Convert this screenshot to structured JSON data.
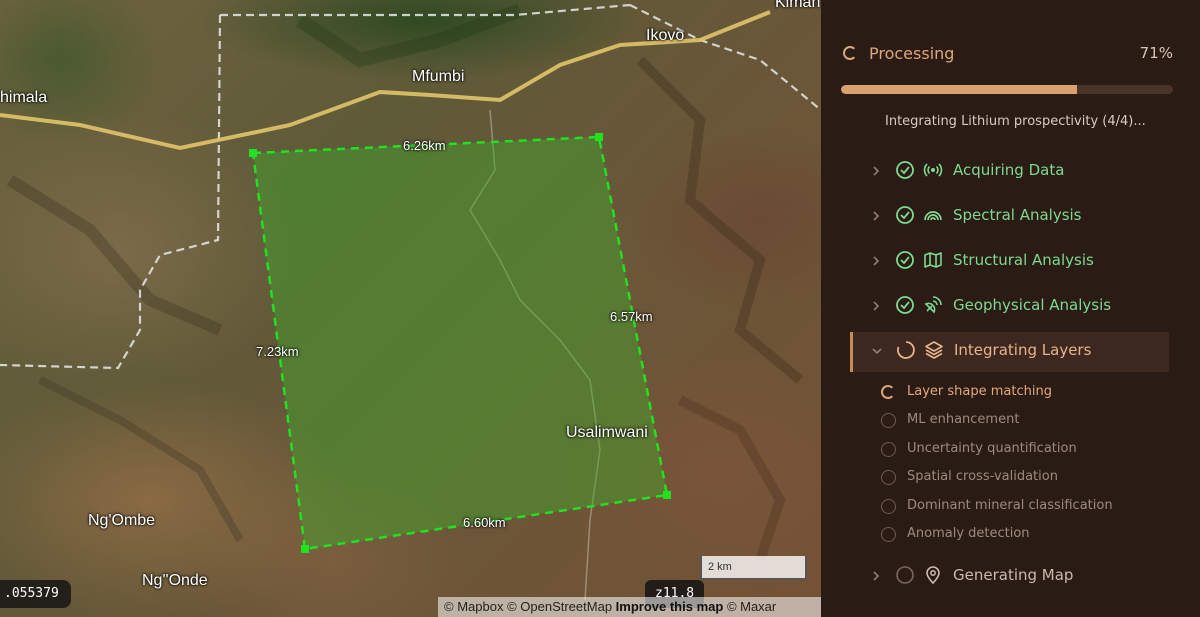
{
  "map": {
    "places": {
      "kimana": "Kiman",
      "ikovo": "Ikovo",
      "mfumbi": "Mfumbi",
      "chimala": "himala",
      "usalimwani": "Usalimwani",
      "ngombe": "Ng'Ombe",
      "ngonde": "Ng''Onde"
    },
    "distances": {
      "top": "6.26km",
      "right": "6.57km",
      "left": "7.23km",
      "bottom": "6.60km"
    },
    "coordinate_readout": ".055379",
    "zoom_level": "z11.8",
    "scale_label": "2 km",
    "attribution": {
      "mapbox": "© Mapbox",
      "osm": "© OpenStreetMap",
      "improve": "Improve this map",
      "maxar": "© Maxar"
    },
    "colors": {
      "selection_stroke": "#22e022",
      "selection_fill": "#3fae2a",
      "road": "#e2c46a"
    }
  },
  "panel": {
    "title": "Processing",
    "progress_percent_label": "71%",
    "progress_value": 0.71,
    "status_text": "Integrating Lithium prospectivity (4/4)...",
    "steps": [
      {
        "label": "Acquiring Data",
        "state": "done",
        "icon": "radio-signal-icon"
      },
      {
        "label": "Spectral Analysis",
        "state": "done",
        "icon": "rainbow-icon"
      },
      {
        "label": "Structural Analysis",
        "state": "done",
        "icon": "map-icon"
      },
      {
        "label": "Geophysical Analysis",
        "state": "done",
        "icon": "satellite-dish-icon"
      },
      {
        "label": "Integrating Layers",
        "state": "active",
        "icon": "layers-icon"
      },
      {
        "label": "Generating Map",
        "state": "pending",
        "icon": "map-pin-icon"
      }
    ],
    "substeps": [
      {
        "label": "Layer shape matching",
        "state": "active"
      },
      {
        "label": "ML enhancement",
        "state": "pending"
      },
      {
        "label": "Uncertainty quantification",
        "state": "pending"
      },
      {
        "label": "Spatial cross-validation",
        "state": "pending"
      },
      {
        "label": "Dominant mineral classification",
        "state": "pending"
      },
      {
        "label": "Anomaly detection",
        "state": "pending"
      }
    ],
    "colors": {
      "accent": "#d9a070",
      "done": "#7fd98e",
      "background": "#2a1b15"
    }
  }
}
